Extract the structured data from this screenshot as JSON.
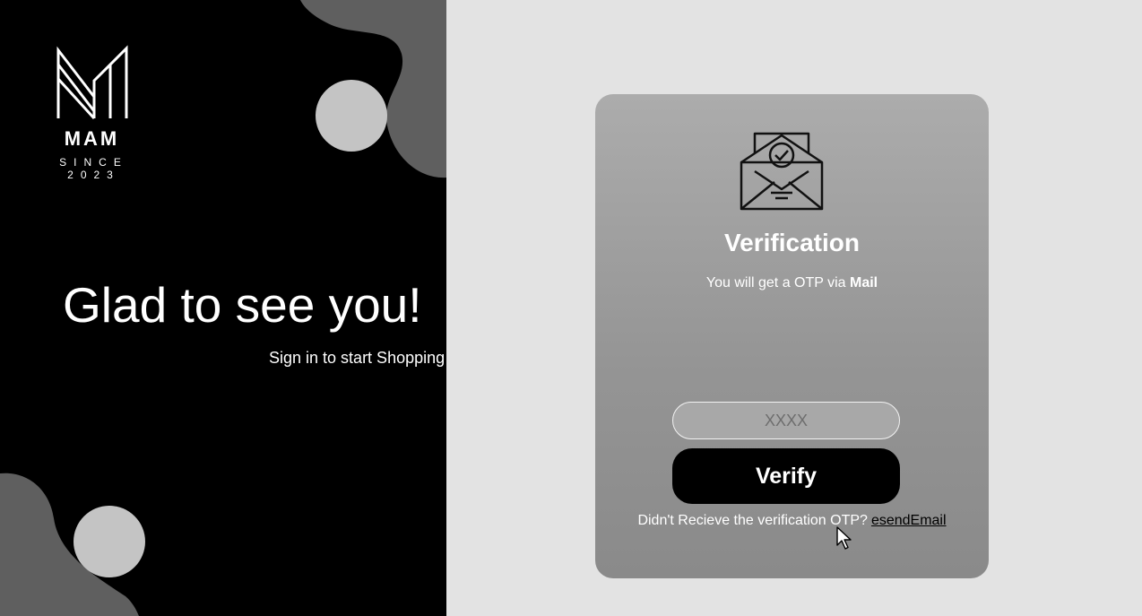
{
  "brand": {
    "name": "MAM",
    "since": "SINCE 2023"
  },
  "welcome": {
    "title": "Glad to see you!",
    "subtitle": "Sign in to start Shopping"
  },
  "verification": {
    "icon": "envelope-check-icon",
    "title": "Verification",
    "description_prefix": "You will get a OTP via ",
    "description_bold": "Mail",
    "otp_placeholder": "XXXX",
    "otp_value": "",
    "verify_label": "Verify",
    "resend_prompt": "Didn't Recieve the verification OTP?",
    "resend_link": "esendEmail"
  },
  "colors": {
    "left_background": "#000000",
    "right_background": "#e3e3e3",
    "card": "#9e9e9e",
    "blob_dark": "#5f5f5f",
    "blob_light": "#c4c4c4",
    "button": "#000000"
  }
}
